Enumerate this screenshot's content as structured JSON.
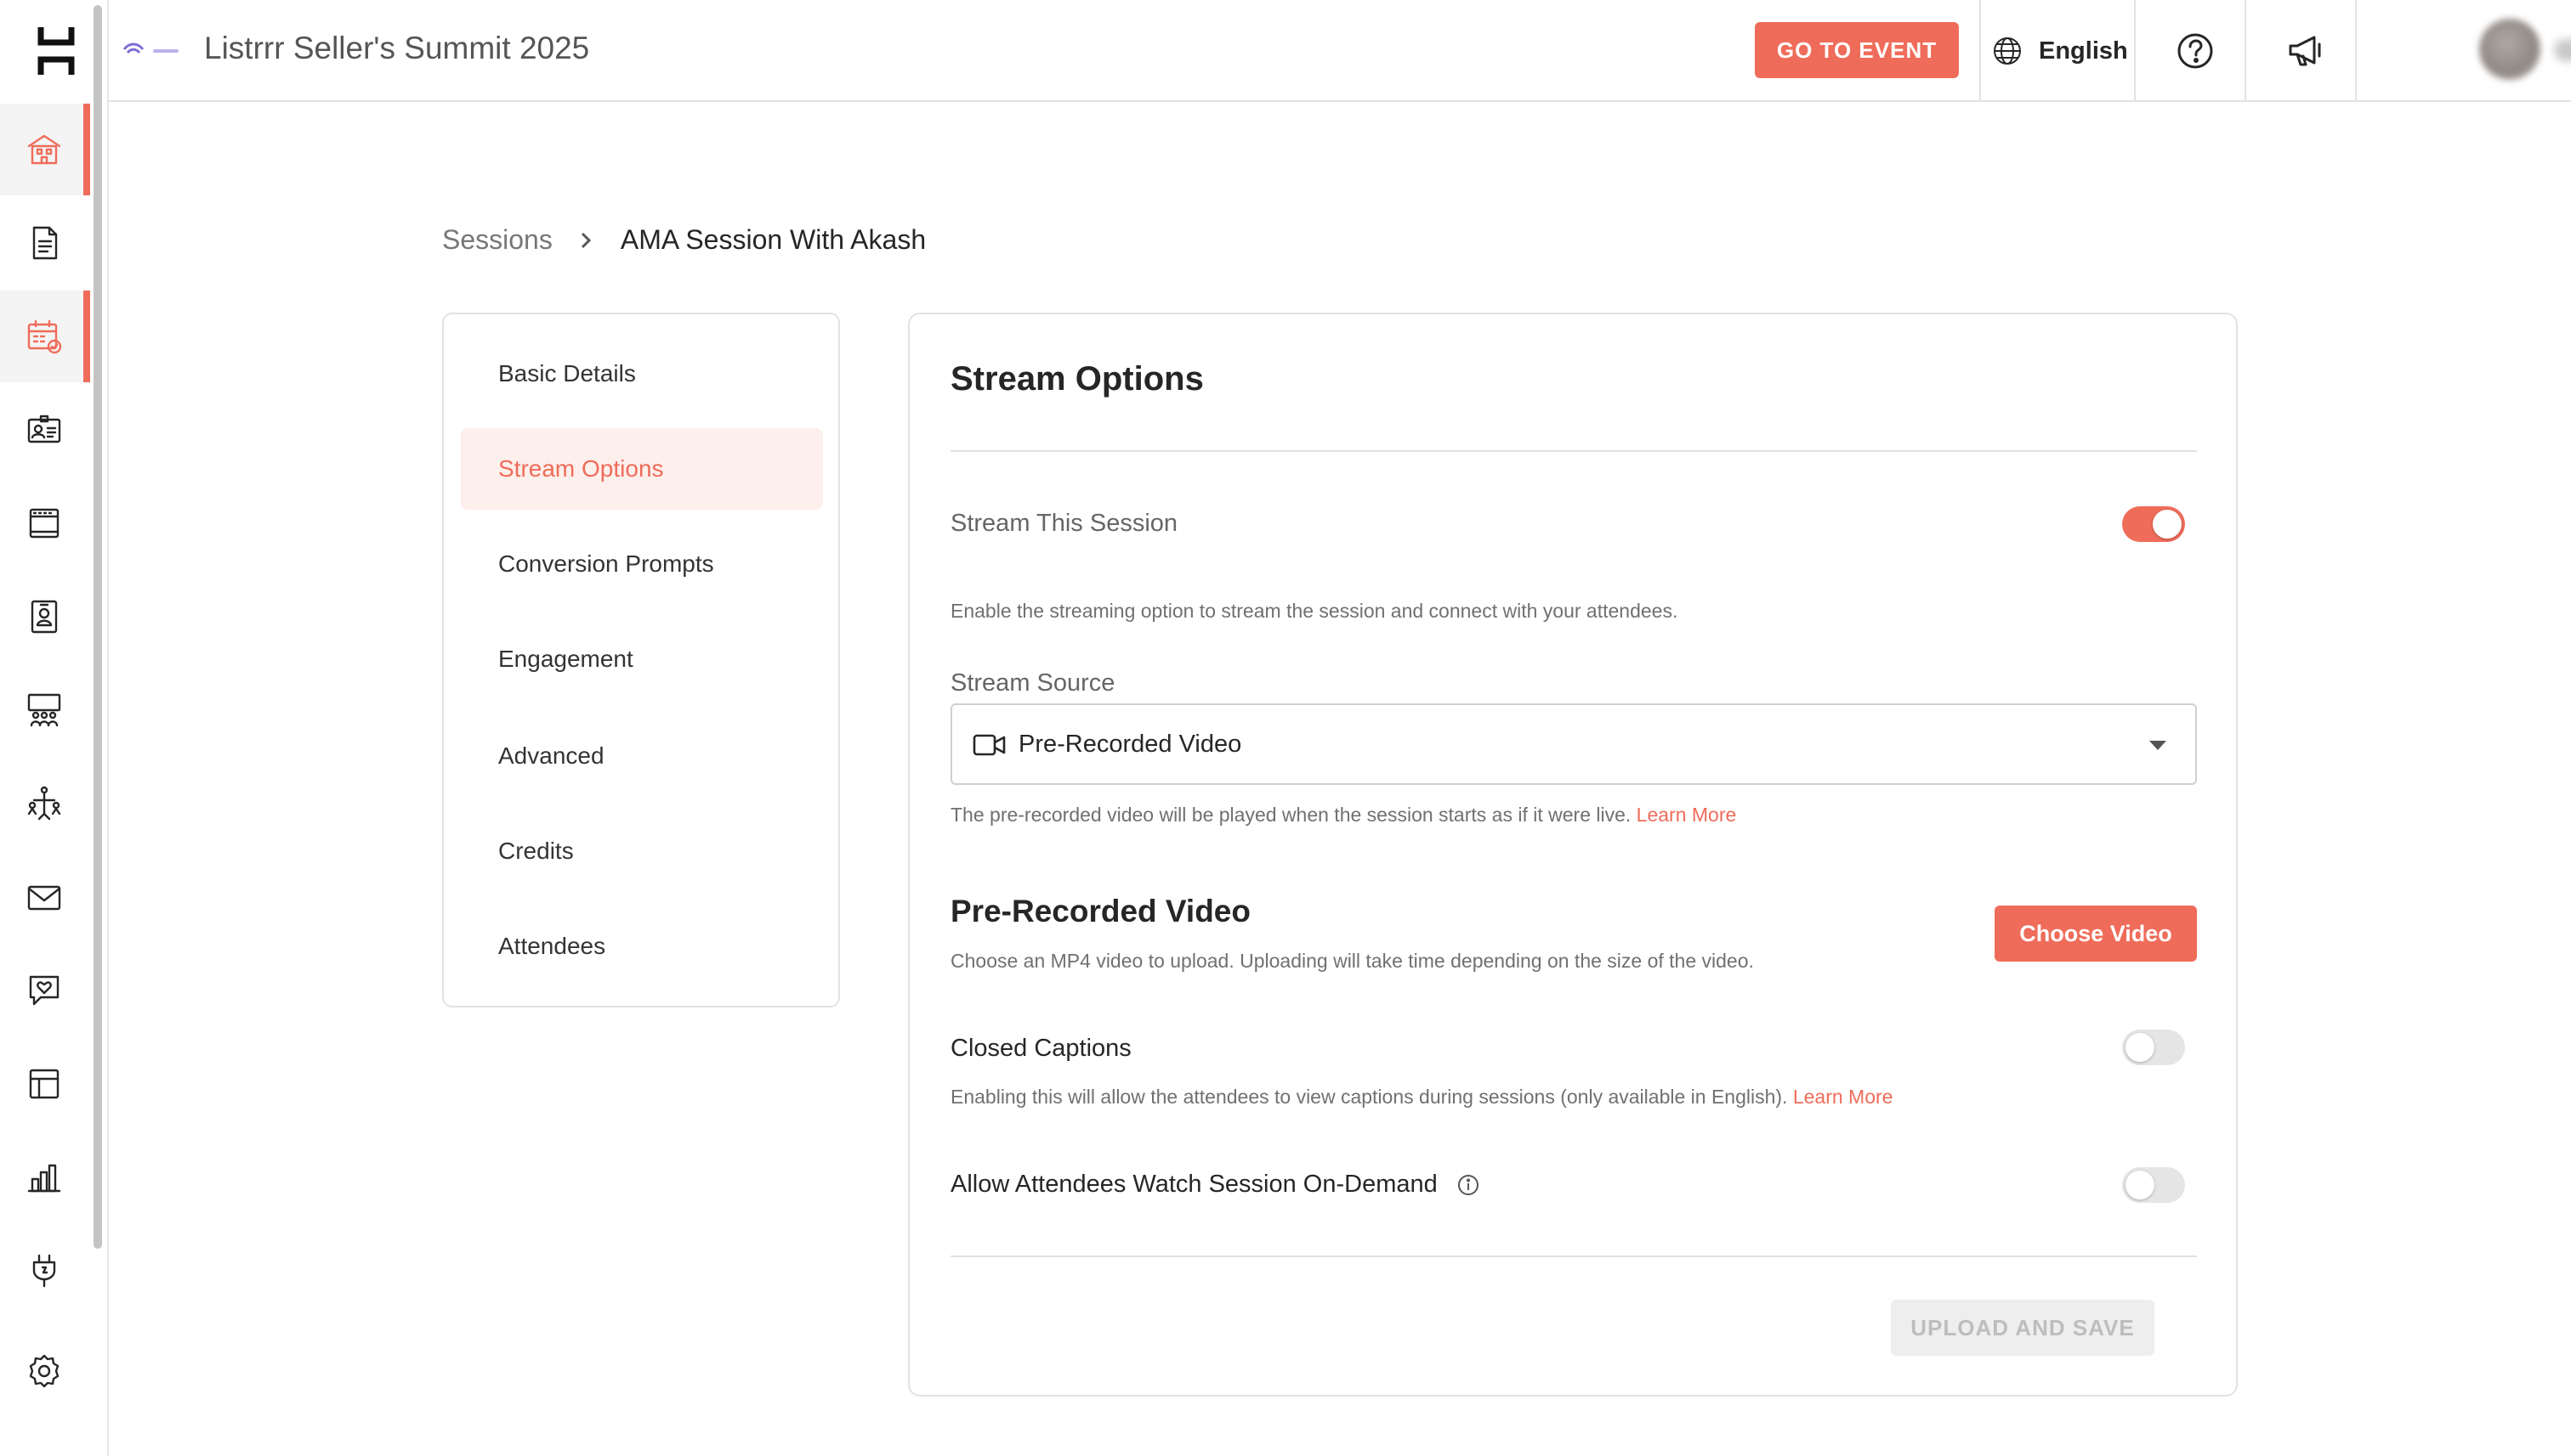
{
  "topbar": {
    "event_title": "Listrrr Seller's Summit 2025",
    "go_to_event": "GO TO EVENT",
    "language": "English",
    "accent_color": "#ef6c5a"
  },
  "breadcrumb": {
    "parent": "Sessions",
    "current": "AMA Session With Akash"
  },
  "side_nav": {
    "items": [
      {
        "label": "Basic Details"
      },
      {
        "label": "Stream Options"
      },
      {
        "label": "Conversion Prompts"
      },
      {
        "label": "Engagement"
      },
      {
        "label": "Advanced"
      },
      {
        "label": "Credits"
      },
      {
        "label": "Attendees"
      }
    ],
    "active": "Stream Options"
  },
  "rail": {
    "icons": [
      "building-icon",
      "document-icon",
      "calendar-icon",
      "id-card-icon",
      "booth-icon",
      "badge-icon",
      "theater-icon",
      "networking-icon",
      "mail-icon",
      "chat-heart-icon",
      "layout-icon",
      "analytics-icon",
      "plug-icon",
      "settings-icon"
    ],
    "active": [
      "building-icon",
      "calendar-icon"
    ]
  },
  "stream_options": {
    "title": "Stream Options",
    "stream_session": {
      "label": "Stream This Session",
      "enabled": true,
      "hint": "Enable the streaming option to stream the session and connect with your attendees."
    },
    "stream_source": {
      "label": "Stream Source",
      "value": "Pre-Recorded Video",
      "hint": "The pre-recorded video will be played when the session starts as if it were live.",
      "learn_more": "Learn More"
    },
    "pre_recorded": {
      "title": "Pre-Recorded Video",
      "hint": "Choose an MP4 video to upload. Uploading will take time depending on the size of the video.",
      "button": "Choose Video"
    },
    "closed_captions": {
      "label": "Closed Captions",
      "enabled": false,
      "hint": "Enabling this will allow the attendees to view captions during sessions (only available in English).",
      "learn_more": "Learn More"
    },
    "on_demand": {
      "label": "Allow Attendees Watch Session On-Demand",
      "enabled": false
    },
    "upload_save": "UPLOAD AND SAVE"
  }
}
